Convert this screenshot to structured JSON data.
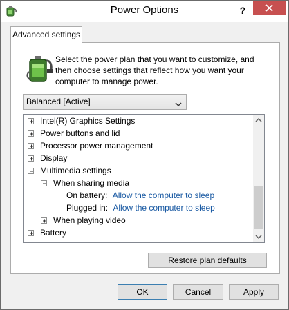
{
  "window": {
    "title": "Power Options",
    "help_label": "?",
    "close_label": "Close"
  },
  "tab": {
    "label": "Advanced settings"
  },
  "description": "Select the power plan that you want to customize, and then choose settings that reflect how you want your computer to manage power.",
  "plan_dropdown": {
    "selected": "Balanced [Active]"
  },
  "tree": {
    "items": [
      {
        "label": "Intel(R) Graphics Settings",
        "state": "collapsed"
      },
      {
        "label": "Power buttons and lid",
        "state": "collapsed"
      },
      {
        "label": "Processor power management",
        "state": "collapsed"
      },
      {
        "label": "Display",
        "state": "collapsed"
      },
      {
        "label": "Multimedia settings",
        "state": "expanded"
      },
      {
        "label": "When sharing media",
        "state": "expanded"
      },
      {
        "label": "On battery:",
        "value": "Allow the computer to sleep"
      },
      {
        "label": "Plugged in:",
        "value": "Allow the computer to sleep"
      },
      {
        "label": "When playing video",
        "state": "collapsed"
      },
      {
        "label": "Battery",
        "state": "collapsed"
      }
    ]
  },
  "buttons": {
    "restore_prefix": "R",
    "restore_rest": "estore plan defaults",
    "ok": "OK",
    "cancel": "Cancel",
    "apply_prefix": "A",
    "apply_rest": "pply"
  },
  "colors": {
    "link": "#1a5aa3",
    "close_button": "#c75050"
  }
}
